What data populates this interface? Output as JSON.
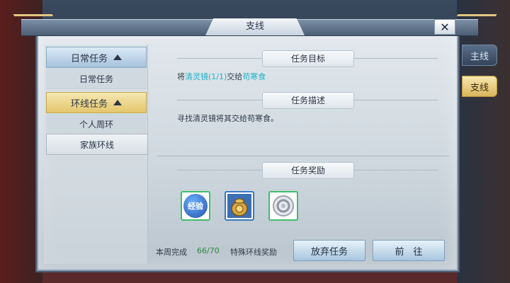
{
  "window": {
    "title": "支线",
    "close_glyph": "✕"
  },
  "sidebar": {
    "categories": [
      {
        "label": "日常任务",
        "children": [
          "日常任务"
        ]
      },
      {
        "label": "环线任务",
        "children": [
          "个人周环",
          "家族环线"
        ]
      }
    ]
  },
  "content": {
    "goal_header": "任务目标",
    "goal_text": {
      "prefix": "将",
      "item": "清灵镜(1/1)",
      "mid": "交给",
      "npc": "苟寒食"
    },
    "desc_header": "任务描述",
    "desc_text": "寻找清灵镜将其交给苟寒食。",
    "reward_header": "任务奖励",
    "rewards": [
      {
        "icon": "exp-icon",
        "label": "经验"
      },
      {
        "icon": "pouch-icon",
        "label": ""
      },
      {
        "icon": "silver-coin-icon",
        "label": ""
      }
    ],
    "weekly_label": "本周完成",
    "weekly_count": "66/70",
    "bonus_label": "特殊环线奖励",
    "abandon_button": "放弃任务",
    "go_button": "前　往"
  },
  "side_tabs": [
    "主线",
    "支线"
  ],
  "colors": {
    "highlight": "#1fb4c8",
    "reward_green": "#3fbf6b",
    "gold_tab": "#e4c66c"
  }
}
